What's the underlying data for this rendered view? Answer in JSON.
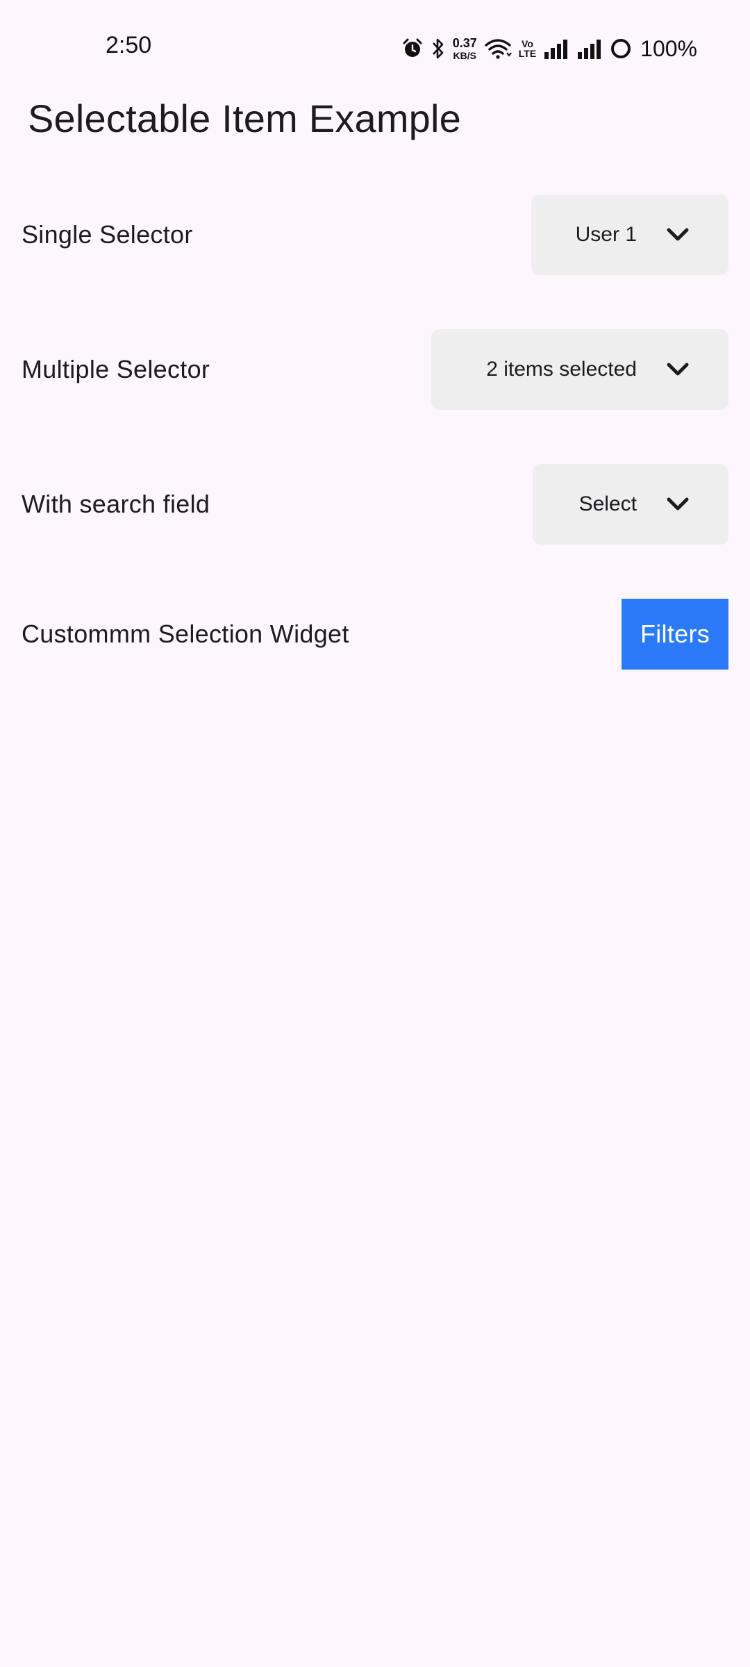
{
  "status_bar": {
    "time": "2:50",
    "net_speed_value": "0.37",
    "net_speed_unit": "KB/S",
    "volte_top": "Vo",
    "volte_bottom": "LTE",
    "battery_percent": "100%",
    "icons": [
      "alarm-icon",
      "bluetooth-icon",
      "wifi-icon",
      "signal-icon",
      "signal-icon",
      "battery-ring-icon"
    ]
  },
  "page": {
    "title": "Selectable Item Example"
  },
  "rows": {
    "single": {
      "label": "Single Selector",
      "value": "User 1"
    },
    "multiple": {
      "label": "Multiple Selector",
      "value": "2 items selected"
    },
    "search": {
      "label": "With search field",
      "value": "Select"
    },
    "custom": {
      "label": "Custommm Selection Widget",
      "button": "Filters"
    }
  },
  "colors": {
    "background": "#fdf6fd",
    "dropdown_bg": "#eeeeee",
    "accent": "#2b7bf8"
  }
}
